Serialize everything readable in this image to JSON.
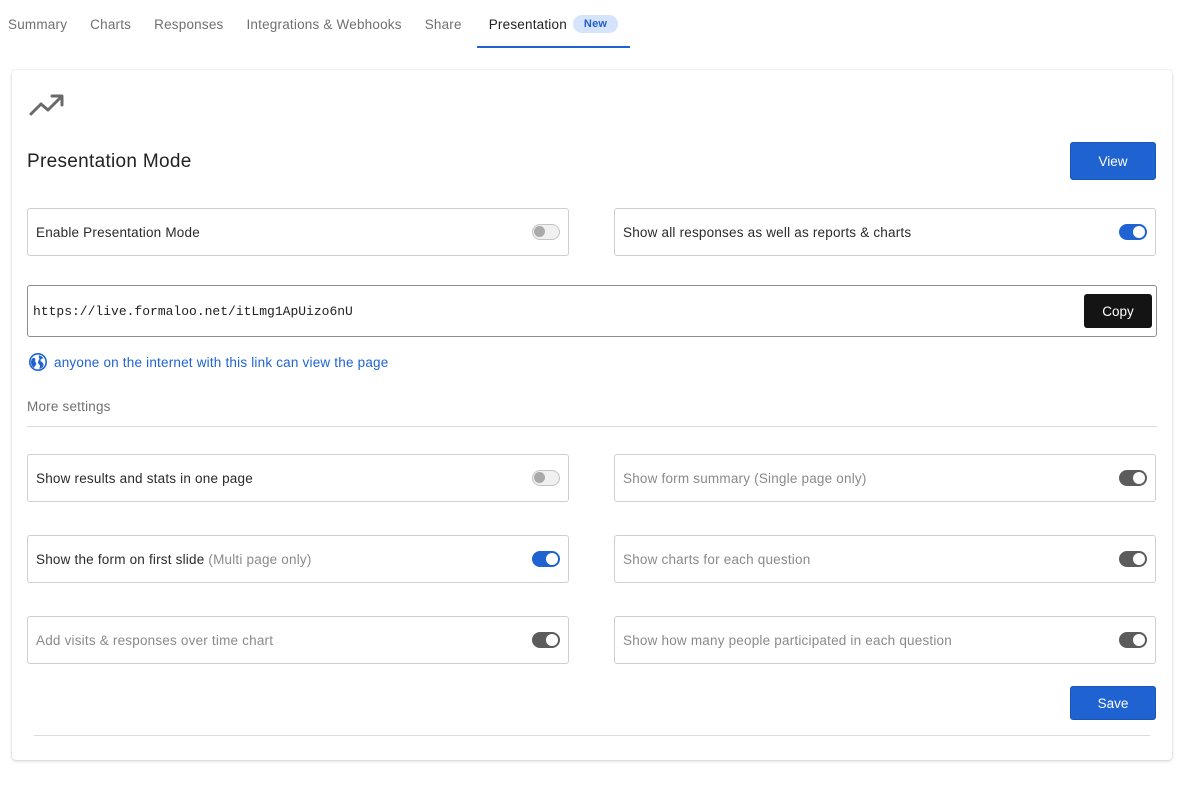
{
  "tabs": [
    {
      "label": "Summary",
      "active": false
    },
    {
      "label": "Charts",
      "active": false
    },
    {
      "label": "Responses",
      "active": false
    },
    {
      "label": "Integrations & Webhooks",
      "active": false
    },
    {
      "label": "Share",
      "active": false
    },
    {
      "label": "Presentation",
      "active": true,
      "badge": "New"
    }
  ],
  "page": {
    "title": "Presentation Mode",
    "view_label": "View",
    "icon": "trending-up-icon"
  },
  "primary_options": {
    "enable_presentation": {
      "label": "Enable Presentation Mode",
      "state": "off"
    },
    "show_all_responses": {
      "label": "Show all responses as well as reports & charts",
      "state": "on"
    }
  },
  "link": {
    "url": "https://live.formaloo.net/itLmg1ApUizo6nU",
    "copy_label": "Copy",
    "public_note": "anyone on the internet with this link can view the page",
    "icon": "globe-icon"
  },
  "more_settings": {
    "heading": "More settings",
    "options": {
      "results_one_page": {
        "label": "Show results and stats in one page",
        "note": "",
        "state": "off",
        "muted": false
      },
      "form_summary": {
        "label": "Show form summary (Single page only)",
        "note": "",
        "state": "on-disabled",
        "muted": true
      },
      "form_first_slide": {
        "label": "Show the form on first slide",
        "note": "(Multi page only)",
        "state": "on",
        "muted": false
      },
      "charts_each_question": {
        "label": "Show charts for each question",
        "note": "",
        "state": "on-disabled",
        "muted": true
      },
      "visits_chart": {
        "label": "Add visits & responses over time chart",
        "note": "",
        "state": "on-disabled",
        "muted": true
      },
      "participation_count": {
        "label": "Show how many people participated in each question",
        "note": "",
        "state": "on-disabled",
        "muted": true
      }
    }
  },
  "save_label": "Save",
  "colors": {
    "accent": "#1f63d3",
    "badge_bg": "#d6e4fb",
    "copy_button": "#141414",
    "toggle_dark": "#5c5c5c"
  }
}
